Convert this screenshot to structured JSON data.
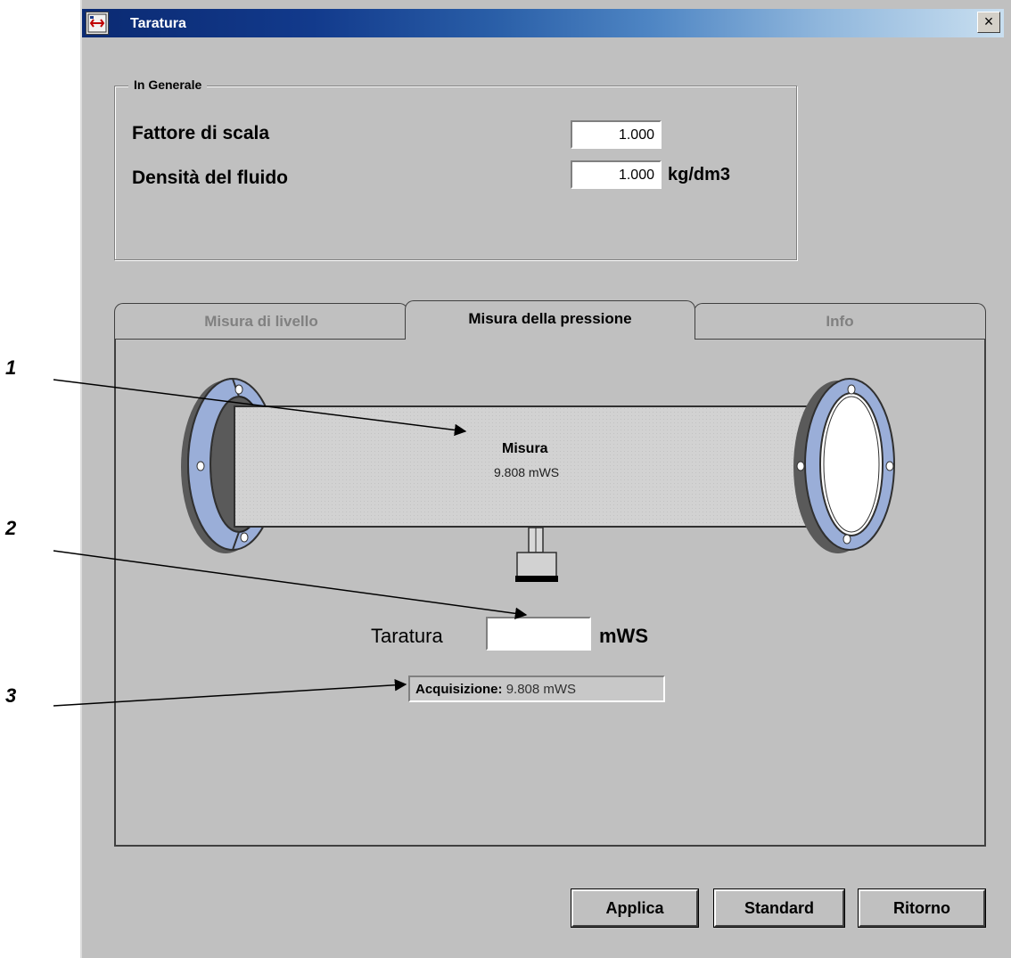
{
  "callouts": [
    "1",
    "2",
    "3"
  ],
  "window": {
    "title": "Taratura",
    "close_glyph": "×"
  },
  "general": {
    "legend": "In Generale",
    "scale_factor_label": "Fattore di scala",
    "scale_factor_value": "1.000",
    "density_label": "Densità del fluido",
    "density_value": "1.000",
    "density_unit": "kg/dm3"
  },
  "tabs": [
    {
      "label": "Misura di livello",
      "active": false
    },
    {
      "label": "Misura della pressione",
      "active": true
    },
    {
      "label": "Info",
      "active": false
    }
  ],
  "pressure": {
    "measure_label": "Misura",
    "measure_value": "9.808 mWS",
    "taratura_label": "Taratura",
    "taratura_value": "",
    "taratura_unit": "mWS",
    "acquisition_label": "Acquisizione:",
    "acquisition_value": "9.808 mWS"
  },
  "buttons": {
    "apply": "Applica",
    "standard": "Standard",
    "return": "Ritorno"
  },
  "colors": {
    "window_bg": "#c0c0c0",
    "flange": "#9aaed8",
    "pipe": "#d0d0d0",
    "title_dark": "#0b2a72"
  }
}
